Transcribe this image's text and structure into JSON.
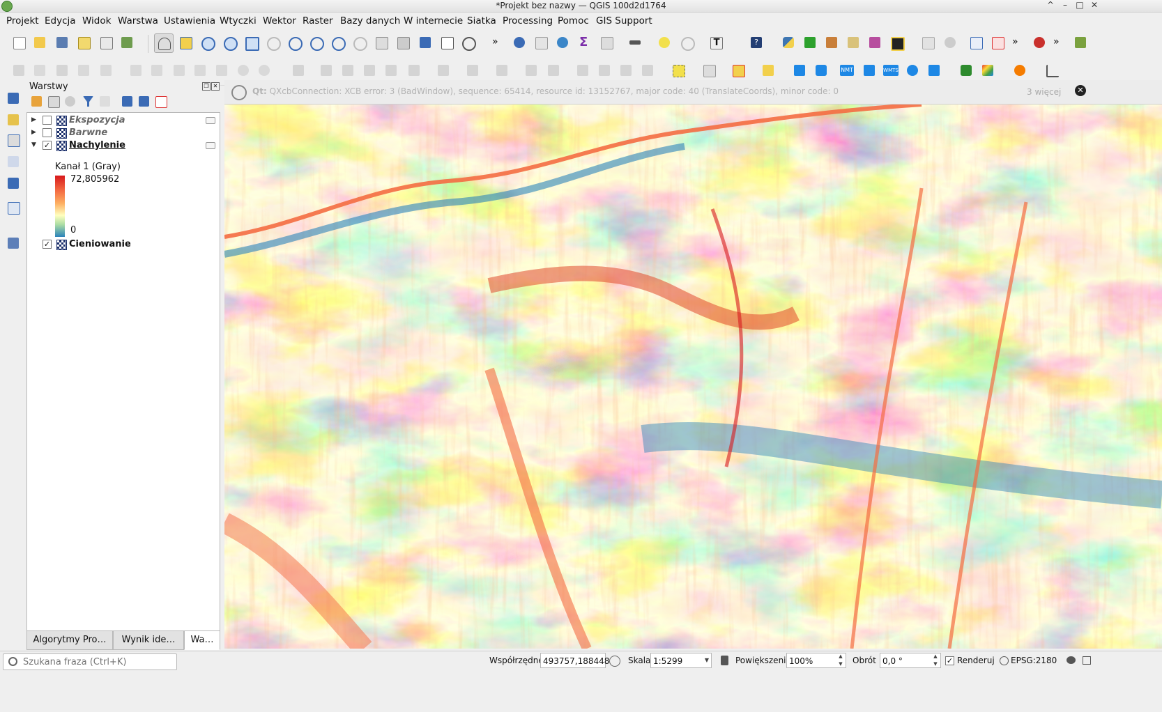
{
  "window": {
    "title": "*Projekt bez nazwy — QGIS 100d2d1764",
    "controls": [
      "^",
      "–",
      "□",
      "✕"
    ]
  },
  "menu": [
    "Projekt",
    "Edycja",
    "Widok",
    "Warstwa",
    "Ustawienia",
    "Wtyczki",
    "Wektor",
    "Raster",
    "Bazy danych",
    "W internecie",
    "Siatka",
    "Processing",
    "Pomoc",
    "GIS Support"
  ],
  "toolbar2_labels": {
    "nmt": "NMT",
    "wmts": "WMTS",
    "more1": "»",
    "more2": "»",
    "more3": "»"
  },
  "layers_panel": {
    "title": "Warstwy",
    "layers": [
      {
        "name": "Ekspozycja",
        "checked": ""
      },
      {
        "name": "Barwne",
        "checked": ""
      },
      {
        "name": "Nachylenie",
        "checked": "✓"
      },
      {
        "name": "Cieniowanie",
        "checked": "✓"
      }
    ],
    "legend": {
      "band": "Kanał 1 (Gray)",
      "max": "72,805962",
      "min": "0"
    },
    "tabs": [
      "Algorytmy Pro…",
      "Wynik ide…",
      "Wa…"
    ]
  },
  "message_bar": {
    "prefix": "Qt:",
    "text": "QXcbConnection: XCB error: 3 (BadWindow), sequence: 65414, resource id: 13152767, major code: 40 (TranslateCoords), minor code: 0",
    "more": "3 więcej"
  },
  "status": {
    "search_placeholder": "Szukana fraza (Ctrl+K)",
    "coord_label": "Współrzędne",
    "coord_value": "493757,188448",
    "scale_label": "Skala",
    "scale_value": "1:5299",
    "magnifier_label": "Powiększenie",
    "magnifier_value": "100%",
    "rotation_label": "Obrót",
    "rotation_value": "0,0 °",
    "render_label": "Renderuj",
    "render_checked": "✓",
    "crs": "EPSG:2180"
  },
  "colors": {
    "ramp_high": "#d7191c",
    "ramp_mid": "#ffffbf",
    "ramp_low": "#2b83ba"
  }
}
